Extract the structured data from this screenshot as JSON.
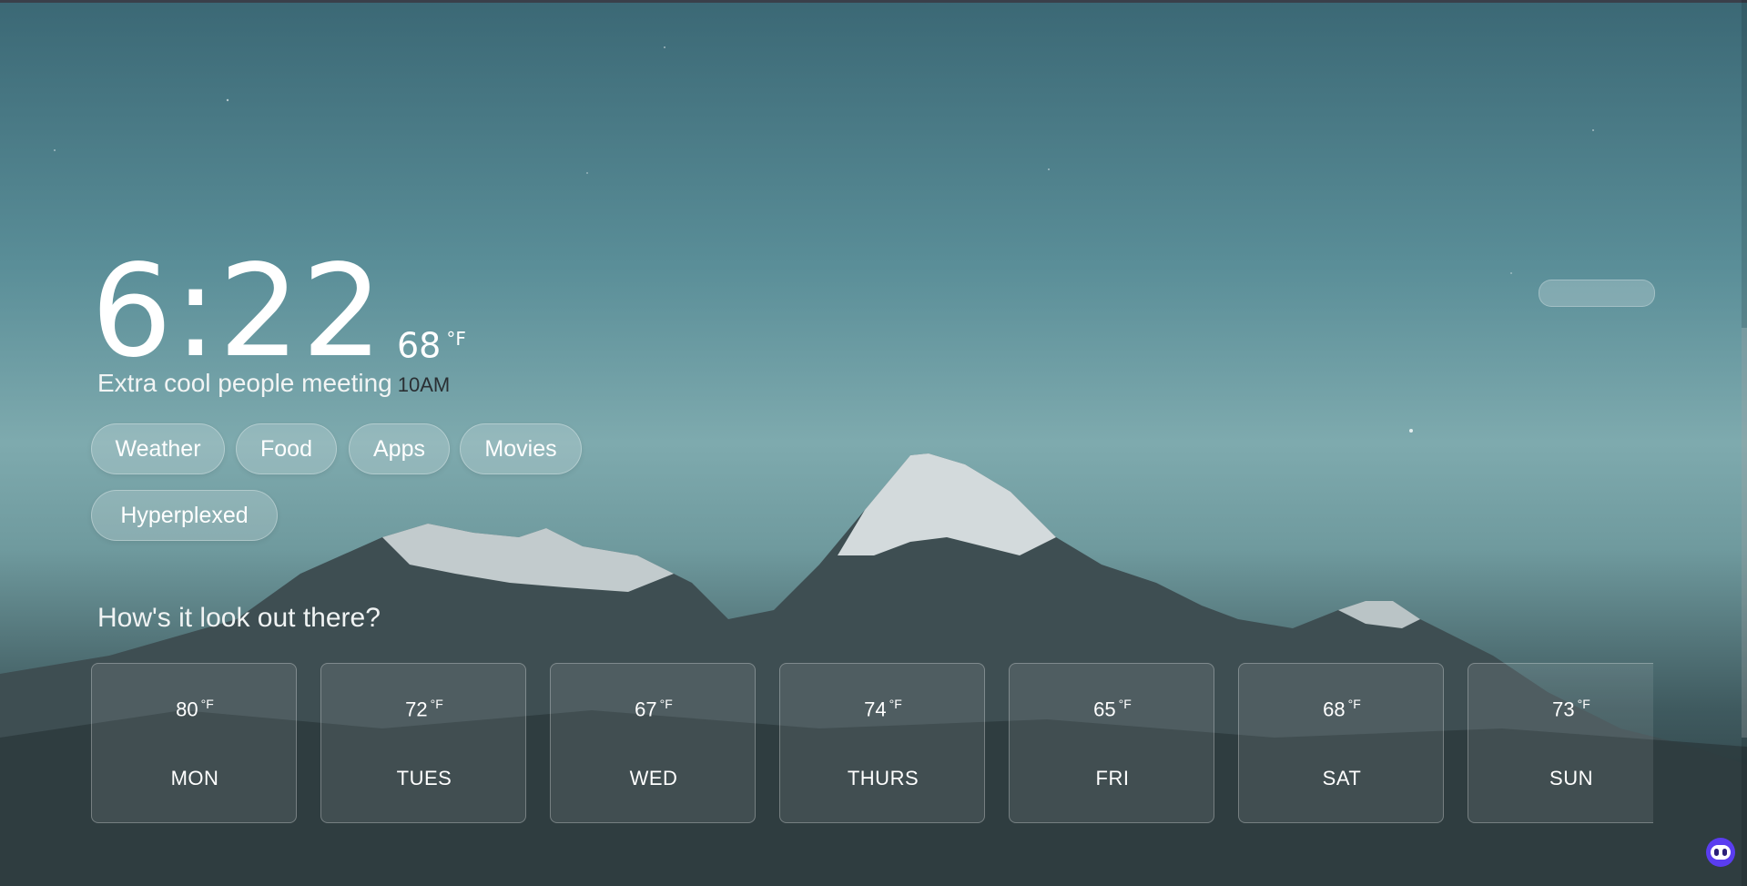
{
  "clock": {
    "time": "6:22"
  },
  "current_weather": {
    "temperature": "68",
    "unit": "°F"
  },
  "event": {
    "title": "Extra cool people meeting",
    "time": "10AM"
  },
  "quick_links": [
    {
      "label": "Weather"
    },
    {
      "label": "Food"
    },
    {
      "label": "Apps"
    },
    {
      "label": "Movies"
    },
    {
      "label": "Hyperplexed"
    }
  ],
  "forecast": {
    "heading": "How's it look out there?",
    "unit": "°F",
    "days": [
      {
        "temp": "80",
        "day": "MON"
      },
      {
        "temp": "72",
        "day": "TUES"
      },
      {
        "temp": "67",
        "day": "WED"
      },
      {
        "temp": "74",
        "day": "THURS"
      },
      {
        "temp": "65",
        "day": "FRI"
      },
      {
        "temp": "68",
        "day": "SAT"
      },
      {
        "temp": "73",
        "day": "SUN"
      }
    ]
  },
  "icons": {
    "assistant": "assistant-bot-icon"
  }
}
